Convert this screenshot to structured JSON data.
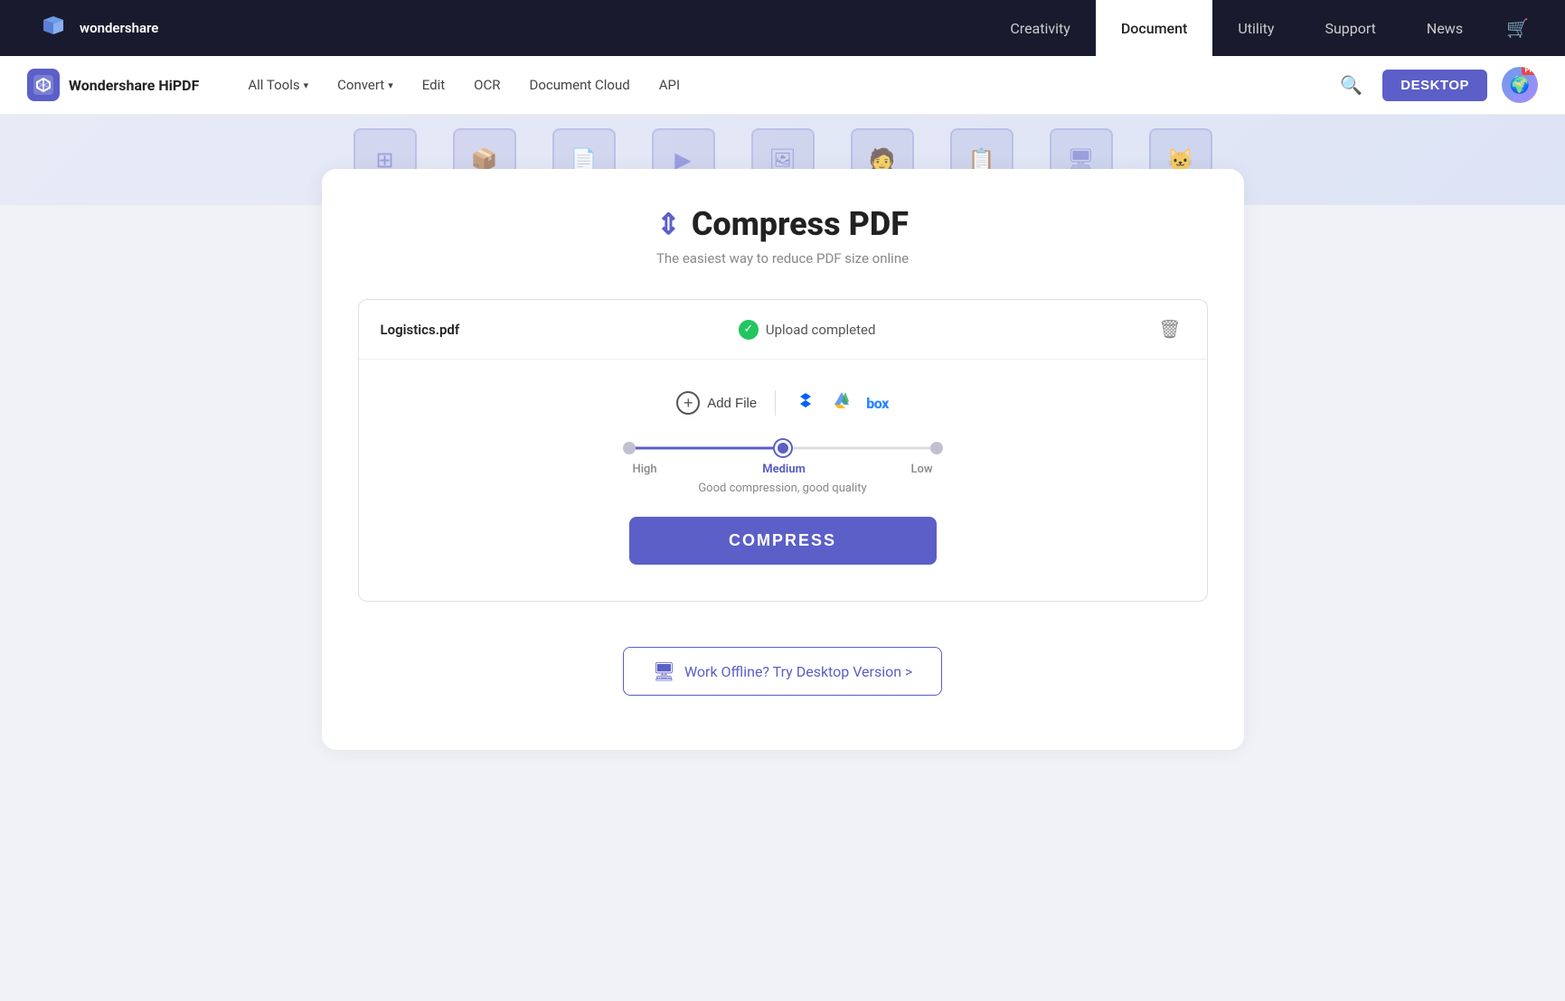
{
  "topNav": {
    "logoText": "wondershare",
    "links": [
      {
        "label": "Creativity",
        "active": false
      },
      {
        "label": "Document",
        "active": true
      },
      {
        "label": "Utility",
        "active": false
      },
      {
        "label": "Support",
        "active": false
      },
      {
        "label": "News",
        "active": false
      }
    ]
  },
  "secNav": {
    "brandName": "Wondershare HiPDF",
    "items": [
      {
        "label": "All Tools",
        "hasDropdown": true
      },
      {
        "label": "Convert",
        "hasDropdown": true
      },
      {
        "label": "Edit",
        "hasDropdown": false
      },
      {
        "label": "OCR",
        "hasDropdown": false
      },
      {
        "label": "Document Cloud",
        "hasDropdown": false
      },
      {
        "label": "API",
        "hasDropdown": false
      }
    ],
    "desktopLabel": "DESKTOP"
  },
  "page": {
    "title": "Compress PDF",
    "subtitle": "The easiest way to reduce PDF size online",
    "fileName": "Logistics.pdf",
    "uploadStatus": "Upload completed",
    "addFileLabel": "Add File",
    "compressionLevels": [
      {
        "label": "High",
        "active": false
      },
      {
        "label": "Medium",
        "active": true
      },
      {
        "label": "Low",
        "active": false
      }
    ],
    "qualityDesc": "Good compression, good quality",
    "compressButton": "COMPRESS",
    "offlineLabel": "Work Offline? Try Desktop Version >"
  }
}
